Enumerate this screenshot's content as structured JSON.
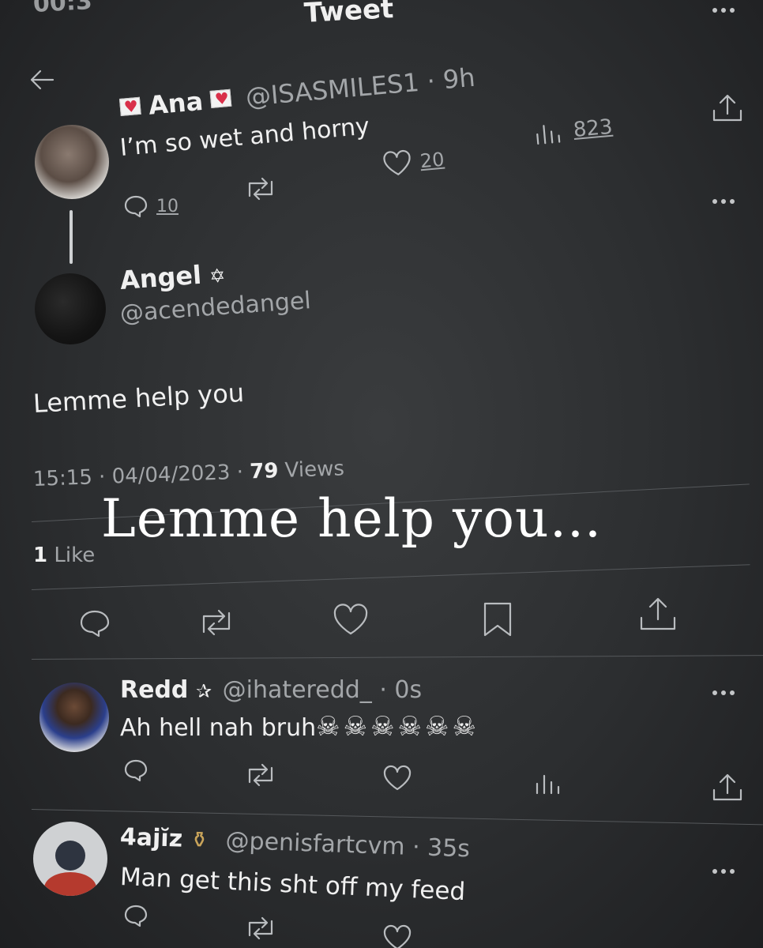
{
  "status_bar": {
    "time": "00:3"
  },
  "header": {
    "title": "Tweet"
  },
  "original_tweet": {
    "name": "Ana",
    "handle": "@ISASMILES1",
    "time": "· 9h",
    "text": "I’m so wet and horny",
    "replies": "10",
    "likes": "20",
    "views": "823"
  },
  "main_tweet": {
    "name": "Angel",
    "badge": "✡",
    "handle": "@acendedangel",
    "text": "Lemme help you",
    "timestamp": "15:15 · 04/04/2023 · ",
    "views_count": "79",
    "views_label": " Views",
    "likes_count": "1",
    "likes_label": " Like",
    "overlay_caption": "Lemme help you…"
  },
  "replies": [
    {
      "name": "Redd",
      "badge": "✰",
      "handle": "@ihateredd_",
      "time": "· 0s",
      "text": "Ah hell nah bruh",
      "emoji": "☠☠☠☠☠☠"
    },
    {
      "name": "4ajĭz",
      "badge": "⚱",
      "handle": "@penisfartcvm",
      "time": "· 35s",
      "text": "Man get this sht off my feed"
    }
  ]
}
